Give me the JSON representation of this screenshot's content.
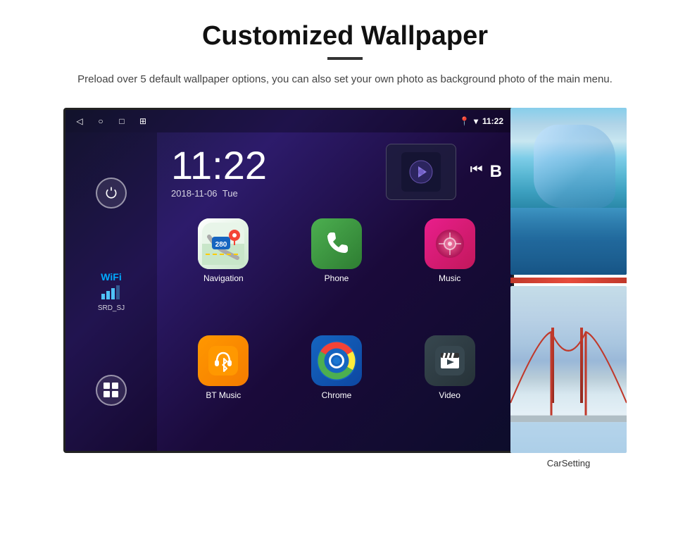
{
  "page": {
    "title": "Customized Wallpaper",
    "description": "Preload over 5 default wallpaper options, you can also set your own photo as background photo of the main menu."
  },
  "status_bar": {
    "time": "11:22",
    "wifi_icon": "📍",
    "signal_icon": "▾"
  },
  "clock": {
    "time": "11:22",
    "date": "2018-11-06",
    "day": "Tue"
  },
  "wifi": {
    "label": "WiFi",
    "network": "SRD_SJ"
  },
  "apps": [
    {
      "id": "navigation",
      "label": "Navigation",
      "icon_type": "navigation"
    },
    {
      "id": "phone",
      "label": "Phone",
      "icon_type": "phone"
    },
    {
      "id": "music",
      "label": "Music",
      "icon_type": "music"
    },
    {
      "id": "bt-music",
      "label": "BT Music",
      "icon_type": "bt-music"
    },
    {
      "id": "chrome",
      "label": "Chrome",
      "icon_type": "chrome"
    },
    {
      "id": "video",
      "label": "Video",
      "icon_type": "video"
    }
  ],
  "wallpapers": {
    "carsetting_label": "CarSetting"
  },
  "nav_buttons": {
    "back": "◁",
    "home": "○",
    "recent": "□",
    "screenshot": "⊞"
  }
}
